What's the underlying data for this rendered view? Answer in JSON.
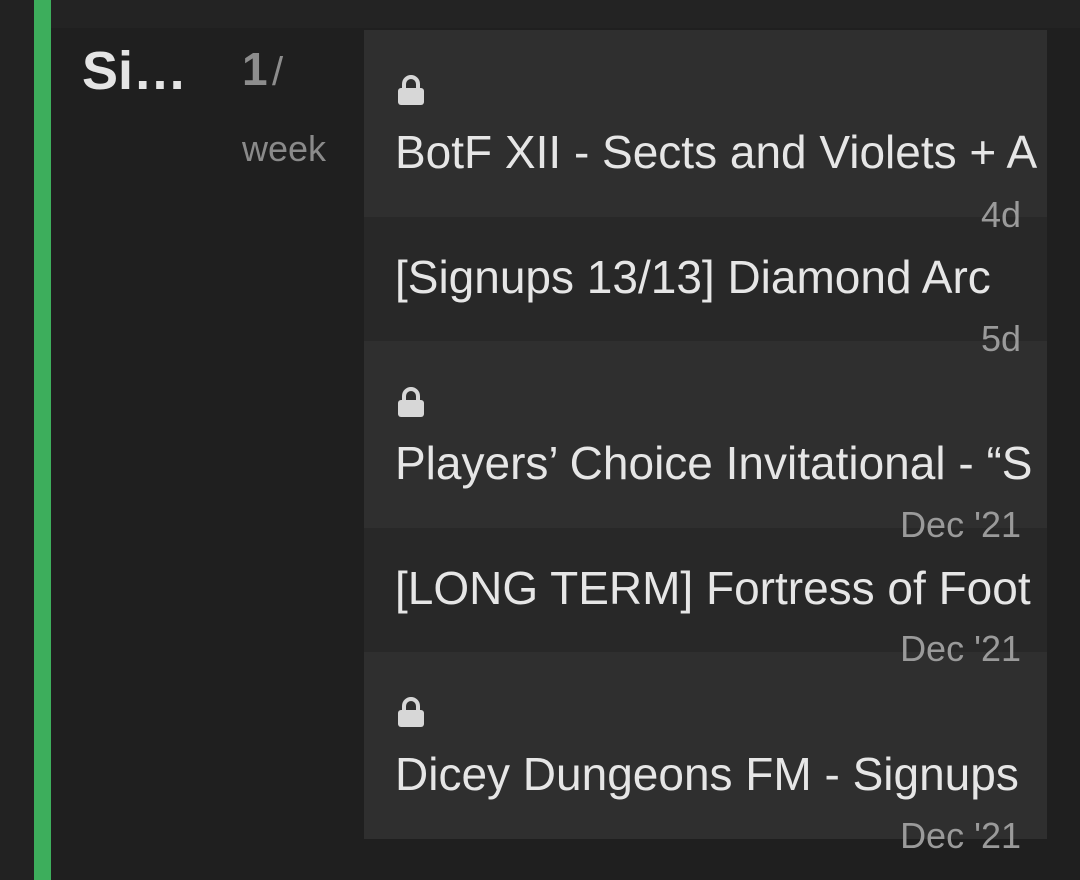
{
  "colors": {
    "accent": "#3dae5c",
    "background": "#1f1f1f",
    "row_light": "#2f2f2f",
    "row_dark": "#282828",
    "text_primary": "#e6e6e6",
    "text_muted": "#9a9a9a"
  },
  "category": {
    "name": "Si…",
    "rate_count": "1",
    "rate_separator": "/",
    "rate_unit": "week"
  },
  "topics": [
    {
      "title": "BotF XII - Sects and Violets + A",
      "age": "4d",
      "locked": true,
      "icon": "lock-icon"
    },
    {
      "title": "[Signups 13/13] Diamond Arc",
      "age": "5d",
      "locked": false
    },
    {
      "title": "Players’ Choice Invitational - “S",
      "age": "Dec '21",
      "locked": true,
      "icon": "lock-icon"
    },
    {
      "title": "[LONG TERM] Fortress of Foot",
      "age": "Dec '21",
      "locked": false
    },
    {
      "title": "Dicey Dungeons FM - Signups",
      "age": "Dec '21",
      "locked": true,
      "icon": "lock-icon"
    }
  ]
}
